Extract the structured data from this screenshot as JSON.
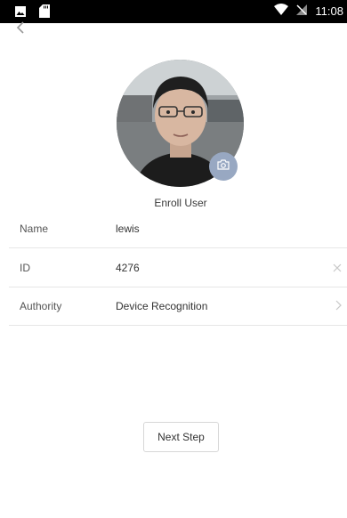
{
  "status_bar": {
    "time": "11:08",
    "icons": [
      "image-notification-icon",
      "sd-card-icon",
      "wifi-icon",
      "no-signal-icon"
    ]
  },
  "header": {
    "back_icon": "chevron-left-icon"
  },
  "profile": {
    "camera_icon": "camera-icon",
    "title": "Enroll User"
  },
  "form": {
    "rows": [
      {
        "label": "Name",
        "value": "lewis"
      },
      {
        "label": "ID",
        "value": "4276",
        "trail_icon": "clear-icon"
      },
      {
        "label": "Authority",
        "value": "Device Recognition",
        "trail_icon": "chevron-right-icon"
      }
    ]
  },
  "actions": {
    "next_label": "Next Step"
  },
  "colors": {
    "status_bar_bg": "#000000",
    "camera_button": "#98a8c2",
    "divider": "#e6e6e6",
    "button_border": "#d7d7d7"
  }
}
